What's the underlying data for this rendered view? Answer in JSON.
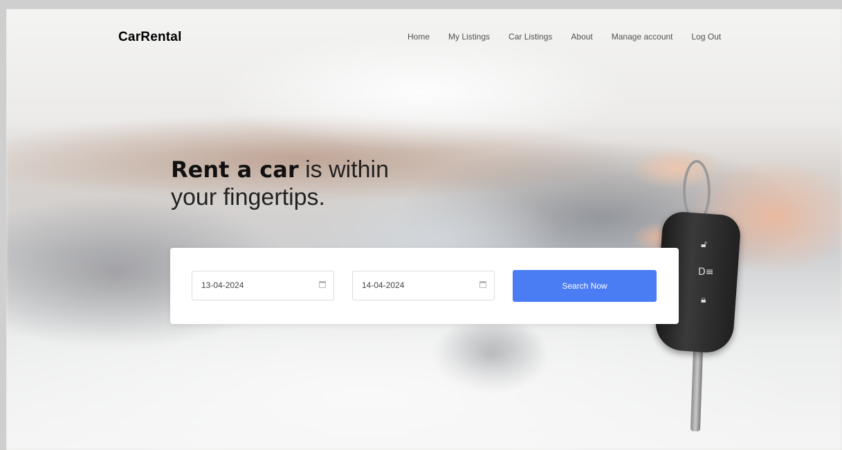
{
  "brand": "CarRental",
  "nav": {
    "items": [
      {
        "label": "Home"
      },
      {
        "label": "My Listings"
      },
      {
        "label": "Car Listings"
      },
      {
        "label": "About"
      },
      {
        "label": "Manage account"
      },
      {
        "label": "Log Out"
      }
    ]
  },
  "hero": {
    "bold_text": "Rent a car",
    "light_text": " is within",
    "line2": "your fingertips."
  },
  "search": {
    "start_date": "13-04-2024",
    "end_date": "14-04-2024",
    "button_label": "Search Now"
  },
  "colors": {
    "accent": "#4a7cf4",
    "card": "#ffffff"
  },
  "icons": {
    "date_field": "calendar-icon"
  }
}
